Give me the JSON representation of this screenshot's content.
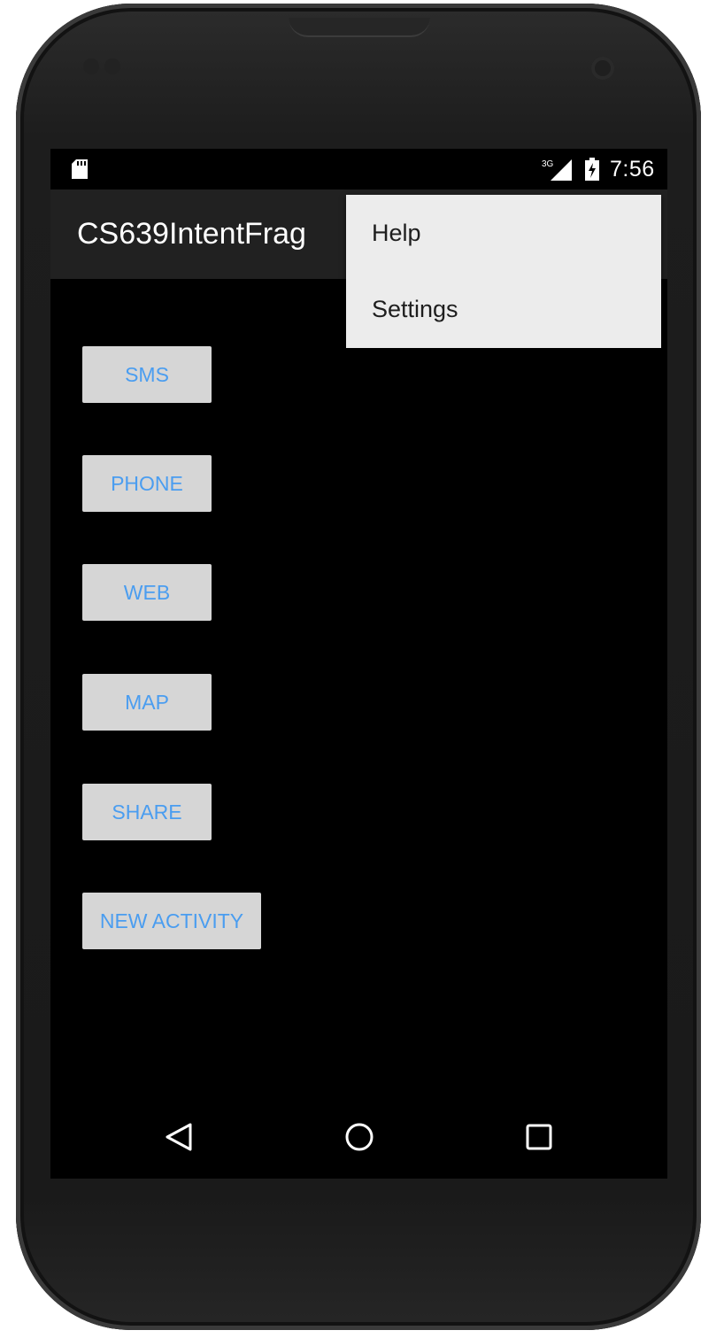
{
  "status_bar": {
    "time": "7:56",
    "network_label": "3G",
    "icons": [
      "sd-card-icon",
      "signal-icon",
      "battery-icon"
    ]
  },
  "action_bar": {
    "title": "CS639IntentFrag"
  },
  "overflow_menu": {
    "items": [
      {
        "label": "Help"
      },
      {
        "label": "Settings"
      }
    ]
  },
  "buttons": [
    {
      "label": "SMS"
    },
    {
      "label": "PHONE"
    },
    {
      "label": "WEB"
    },
    {
      "label": "MAP"
    },
    {
      "label": "SHARE"
    },
    {
      "label": "NEW ACTIVITY"
    }
  ],
  "nav_bar": {
    "icons": [
      "back-icon",
      "home-icon",
      "recents-icon"
    ]
  },
  "colors": {
    "button_text": "#4a9df0",
    "button_bg": "#d6d6d6",
    "action_bar_bg": "#212121",
    "menu_bg": "#ececec",
    "screen_bg": "#000000"
  }
}
